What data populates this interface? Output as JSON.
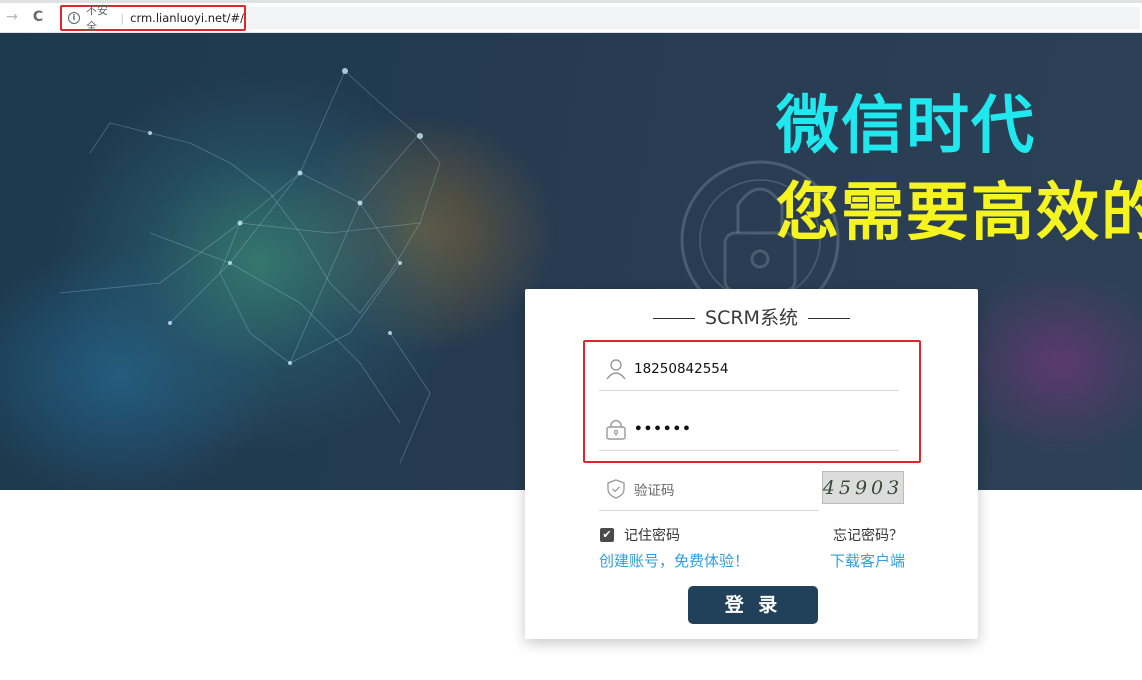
{
  "browser": {
    "forward_icon": "→",
    "reload_icon": "C",
    "security_label": "不安全",
    "url": "crm.lianluoyi.net/#/"
  },
  "hero": {
    "line1": "微信时代",
    "line2": "您需要高效的",
    "line1_color": "#1fe8ef",
    "line2_color": "#f6f41e"
  },
  "login": {
    "title": "SCRM系统",
    "username": "18250842554",
    "password_masked": "••••••",
    "captcha_placeholder": "验证码",
    "captcha_code": "45903",
    "remember_label": "记住密码",
    "remember_checked": true,
    "forgot_label": "忘记密码？",
    "create_account_label": "创建账号，免费体验！",
    "download_label": "下载客户端",
    "submit_label": "登 录",
    "accent_color": "#21405a",
    "link_color": "#2e9fe0",
    "highlight_color": "#e02626"
  }
}
